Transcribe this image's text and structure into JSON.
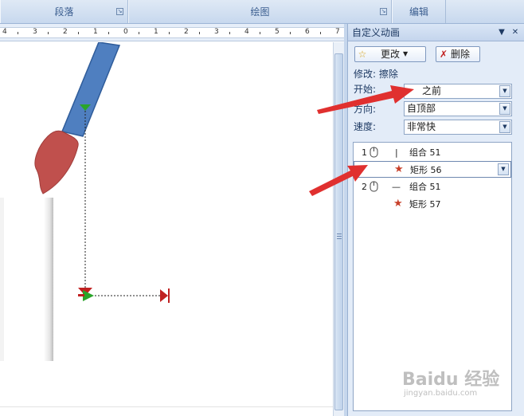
{
  "ribbon": {
    "groups": [
      "段落",
      "绘图",
      "编辑"
    ]
  },
  "ruler": {
    "labels": [
      "4",
      "3",
      "2",
      "1",
      "0",
      "1",
      "2",
      "3",
      "4",
      "5",
      "6",
      "7"
    ]
  },
  "task_pane": {
    "title": "自定义动画",
    "change_button": "更改",
    "remove_button": "删除",
    "modify_label": "修改: 擦除",
    "start_label": "开始:",
    "start_value": "之前",
    "direction_label": "方向:",
    "direction_value": "自顶部",
    "speed_label": "速度:",
    "speed_value": "非常快",
    "list": [
      {
        "number": "1",
        "symbol": "|",
        "text": "组合 51"
      },
      {
        "number": "",
        "symbol": "",
        "text": "矩形 56"
      },
      {
        "number": "2",
        "symbol": "—",
        "text": "组合 51"
      },
      {
        "number": "",
        "symbol": "",
        "text": "矩形 57"
      }
    ]
  },
  "watermark": {
    "main": "Baidu 经验",
    "sub": "jingyan.baidu.com"
  },
  "colors": {
    "brush_handle": "#4f7fc0",
    "brush_head": "#c0504d",
    "annotation_arrow": "#e0302f",
    "path_start": "#2aa52a",
    "path_end": "#c02020"
  }
}
